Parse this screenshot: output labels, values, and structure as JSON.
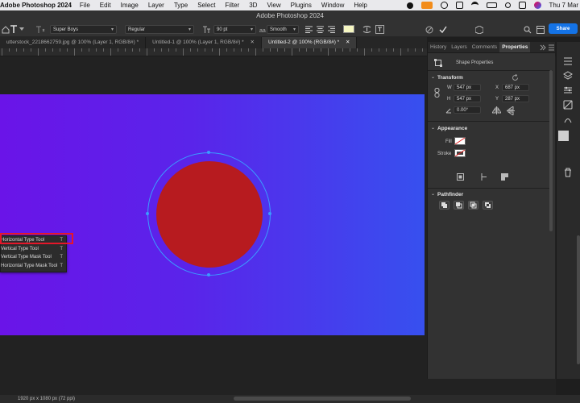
{
  "menubar": {
    "app": "Adobe Photoshop 2024",
    "items": [
      "File",
      "Edit",
      "Image",
      "Layer",
      "Type",
      "Select",
      "Filter",
      "3D",
      "View",
      "Plugins",
      "Window",
      "Help"
    ],
    "clock": "Thu 7 Mar"
  },
  "window": {
    "title": "Adobe Photoshop 2024"
  },
  "options": {
    "font_family": "Super Boys",
    "font_style": "Regular",
    "font_size": "90 pt",
    "antialias": "Smooth",
    "share_label": "Share",
    "swatch_color": "#f6f7c2"
  },
  "tabs": [
    {
      "label": "utterstock_2218662759.jpg @ 100% (Layer 1, RGB/8#) *",
      "close": ""
    },
    {
      "label": "Untitled-1 @ 100% (Layer 1, RGB/8#) *",
      "close": "✕"
    },
    {
      "label": "Untitled-2 @ 100% (RGB/8#) *",
      "close": "✕"
    }
  ],
  "canvas": {
    "circle_color": "#b71b1f",
    "selection_color": "#3b9bff"
  },
  "flyout": [
    {
      "label": "Horizontal Type Tool",
      "shortcut": "T"
    },
    {
      "label": "Vertical Type Tool",
      "shortcut": "T"
    },
    {
      "label": "Vertical Type Mask Tool",
      "shortcut": "T"
    },
    {
      "label": "Horizontal Type Mask Tool",
      "shortcut": "T"
    }
  ],
  "panel": {
    "tabs": [
      "History",
      "Layers",
      "Comments",
      "Properties"
    ],
    "header": "Shape Properties",
    "transform": {
      "title": "Transform",
      "w_label": "W",
      "w": "547 px",
      "x_label": "X",
      "x": "687 px",
      "h_label": "H",
      "h": "547 px",
      "y_label": "Y",
      "y": "287 px",
      "angle": "0.00°"
    },
    "appearance": {
      "title": "Appearance",
      "fill_label": "Fill",
      "stroke_label": "Stroke"
    },
    "pathfinder": {
      "title": "Pathfinder"
    }
  },
  "status": {
    "text": "1920 px x 1080 px (72 ppi)"
  }
}
